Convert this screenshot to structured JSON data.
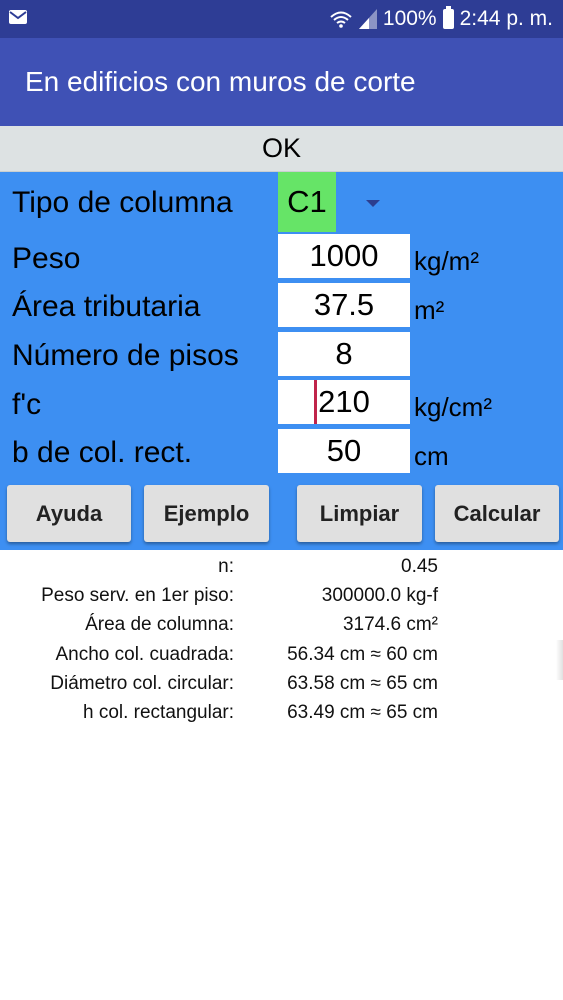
{
  "status_bar": {
    "battery": "100%",
    "time": "2:44 p. m.",
    "icons": [
      "mail-icon",
      "wifi-icon",
      "signal-icon",
      "battery-icon"
    ]
  },
  "app_bar": {
    "title": "En edificios con muros de corte"
  },
  "ok_bar": {
    "label": "OK"
  },
  "form": {
    "tipo_columna": {
      "label": "Tipo de columna",
      "value": "C1"
    },
    "peso": {
      "label": "Peso",
      "value": "1000",
      "unit": "kg/m²"
    },
    "area_tributaria": {
      "label": "Área tributaria",
      "value": "37.5",
      "unit": "m²"
    },
    "numero_pisos": {
      "label": "Número de pisos",
      "value": "8"
    },
    "fc": {
      "label": "f'c",
      "value": "210",
      "unit": "kg/cm²"
    },
    "b_col": {
      "label": "b de col. rect.",
      "value": "50",
      "unit": "cm"
    }
  },
  "buttons": {
    "ayuda": "Ayuda",
    "ejemplo": "Ejemplo",
    "limpiar": "Limpiar",
    "calcular": "Calcular"
  },
  "results": [
    {
      "key": "n:",
      "value": "0.45"
    },
    {
      "key": "Peso serv. en 1er piso:",
      "value": "300000.0 kg-f"
    },
    {
      "key": "Área de columna:",
      "value": "3174.6 cm²"
    },
    {
      "key": "Ancho col. cuadrada:",
      "value": "56.34 cm  ≈  60 cm"
    },
    {
      "key": "Diámetro col. circular:",
      "value": "63.58 cm  ≈  65 cm"
    },
    {
      "key": "h col. rectangular:",
      "value": "63.49 cm  ≈  65 cm"
    }
  ],
  "colors": {
    "status_bar": "#2e3d95",
    "app_bar": "#3f51b5",
    "form_background": "#3d8ff2",
    "select_background": "#66e467",
    "cursor": "#c0244a"
  }
}
